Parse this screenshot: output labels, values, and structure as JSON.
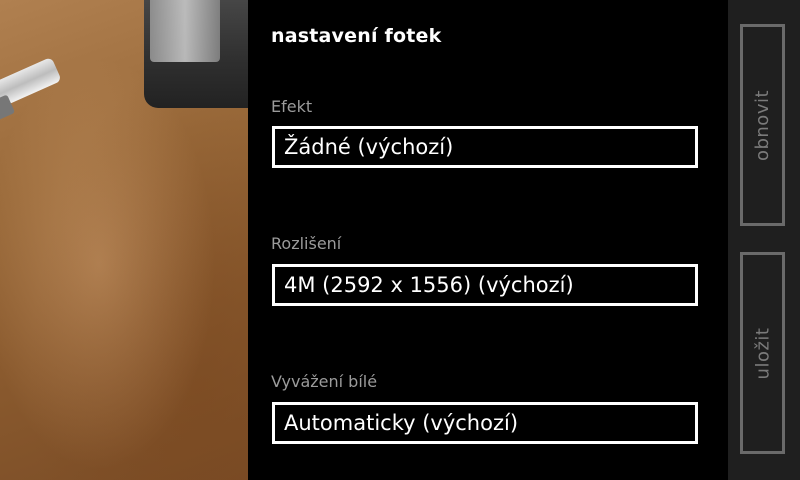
{
  "panel": {
    "title": "nastavení fotek",
    "fields": [
      {
        "label": "Efekt",
        "value": "Žádné (výchozí)"
      },
      {
        "label": "Rozlišení",
        "value": "4M (2592 x 1556) (výchozí)"
      },
      {
        "label": "Vyvážení bílé",
        "value": "Automaticky (výchozí)"
      }
    ]
  },
  "appbar": {
    "reset_label": "obnovit",
    "save_label": "uložit"
  },
  "colors": {
    "background": "#000000",
    "label": "#9b9b9b",
    "appbar": "#1f1f1f",
    "appbar_button": "#7a7a7a"
  }
}
